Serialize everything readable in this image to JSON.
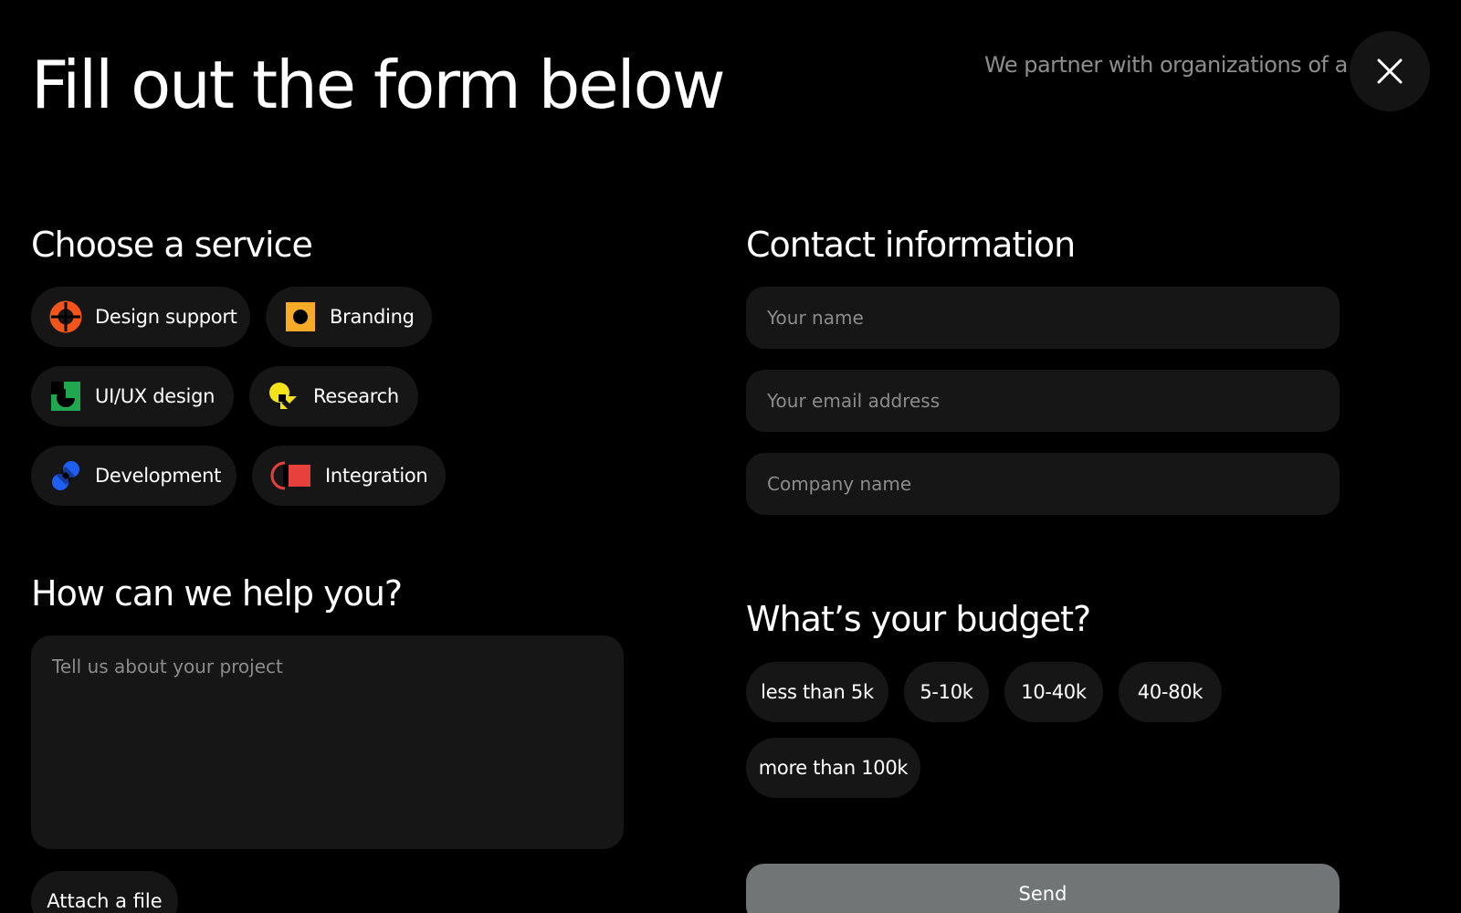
{
  "header": {
    "title": "Fill out the form below",
    "intro": "We partner with organizations of all sizes across all sectors.",
    "close_icon": "close-icon"
  },
  "services": {
    "title": "Choose a service",
    "items": [
      {
        "label": "Design support",
        "icon": "design-support-icon",
        "color": "#f2541b"
      },
      {
        "label": "Branding",
        "icon": "branding-icon",
        "color": "#f7a928"
      },
      {
        "label": "UI/UX design",
        "icon": "uiux-design-icon",
        "color": "#1fa84f"
      },
      {
        "label": "Research",
        "icon": "research-icon",
        "color": "#f5e31a"
      },
      {
        "label": "Development",
        "icon": "development-icon",
        "color": "#1f5ef2"
      },
      {
        "label": "Integration",
        "icon": "integration-icon",
        "color": "#e8403d"
      }
    ]
  },
  "help": {
    "title": "How can we help you?",
    "placeholder": "Tell us about your project",
    "attach_label": "Attach a file"
  },
  "contact": {
    "title": "Contact information",
    "name_placeholder": "Your name",
    "email_placeholder": "Your email address",
    "company_placeholder": "Company name"
  },
  "budget": {
    "title": "What’s your budget?",
    "options": [
      "less than 5k",
      "5-10k",
      "10-40k",
      "40-80k",
      "more than 100k"
    ]
  },
  "send_label": "Send"
}
